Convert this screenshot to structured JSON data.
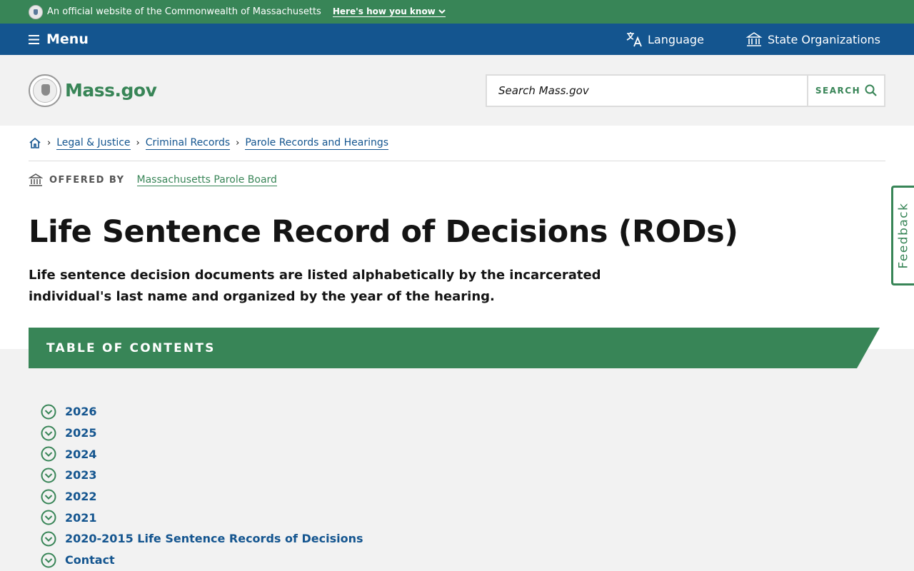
{
  "official_banner": {
    "text": "An official website of the Commonwealth of Massachusetts",
    "how_link": "Here's how you know"
  },
  "utility_nav": {
    "menu_label": "Menu",
    "language_label": "Language",
    "state_orgs_label": "State Organizations"
  },
  "header": {
    "logo_text": "Mass.gov",
    "search_placeholder": "Search Mass.gov",
    "search_button": "SEARCH"
  },
  "breadcrumb": {
    "items": [
      "Legal & Justice",
      "Criminal Records",
      "Parole Records and Hearings"
    ]
  },
  "offered_by": {
    "label": "OFFERED BY",
    "org": "Massachusetts Parole Board"
  },
  "page": {
    "title": "Life Sentence Record of Decisions (RODs)",
    "lede": "Life sentence decision documents are listed alphabetically by the incarcerated individual's last name and organized by the year of the hearing."
  },
  "toc": {
    "heading": "TABLE OF CONTENTS",
    "items": [
      "2026",
      "2025",
      "2024",
      "2023",
      "2022",
      "2021",
      "2020-2015 Life Sentence Records of Decisions",
      "Contact"
    ]
  },
  "feedback": {
    "label": "Feedback"
  },
  "colors": {
    "green": "#388557",
    "blue": "#14558f",
    "background": "#f2f2f2"
  }
}
